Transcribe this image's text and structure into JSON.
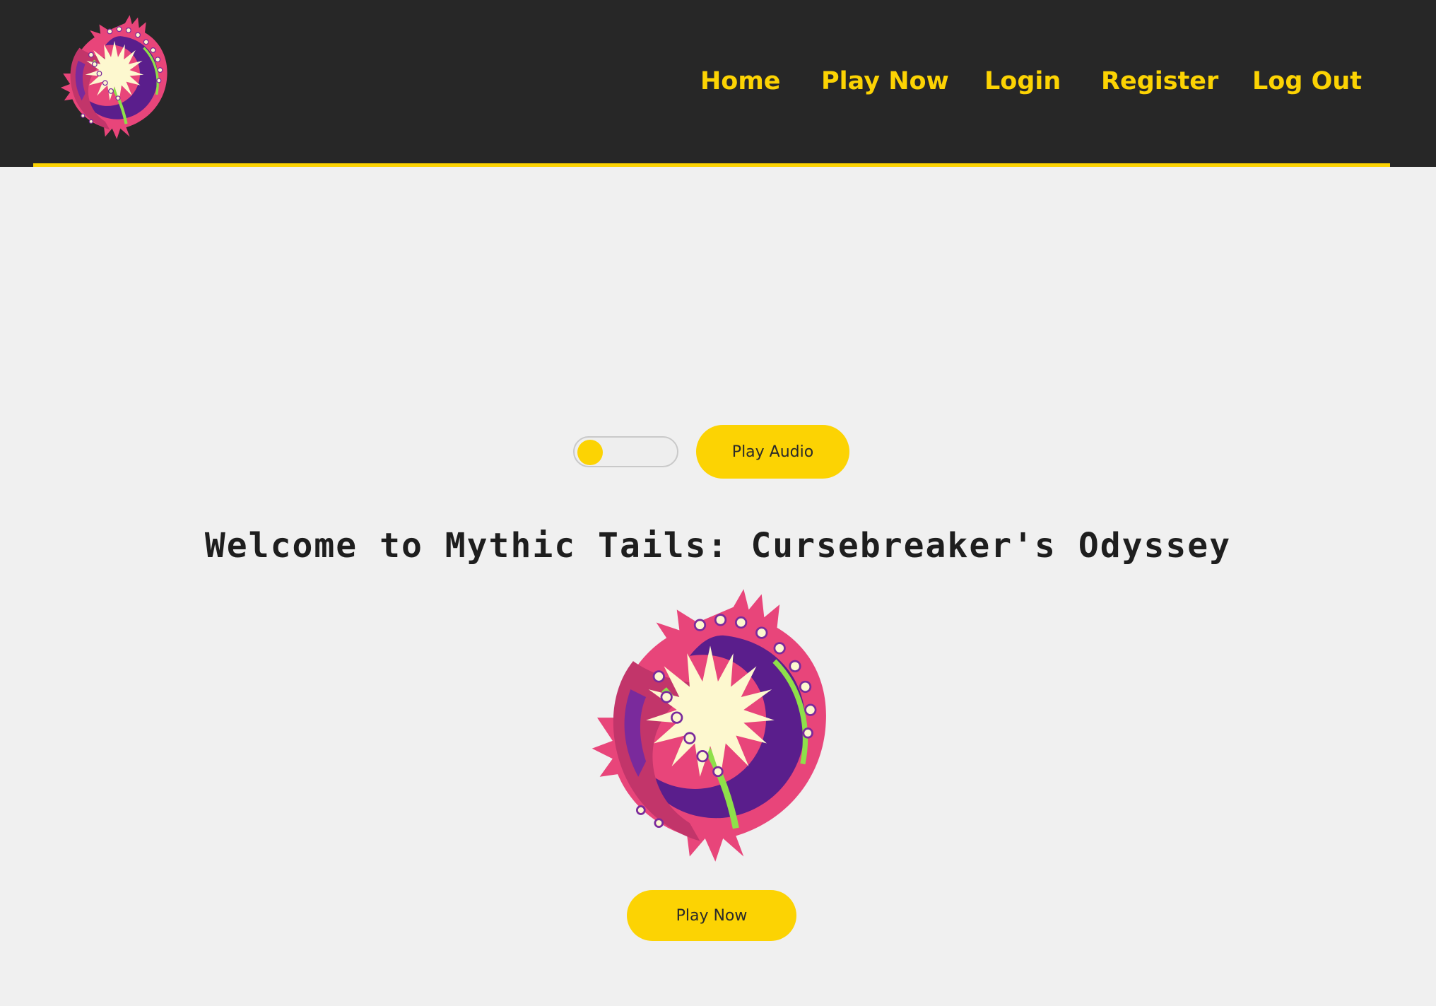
{
  "header": {
    "logo_icon": "serpent-sun-logo",
    "nav": {
      "home": "Home",
      "play_now": "Play Now",
      "login": "Login",
      "register": "Register",
      "log_out": "Log Out"
    }
  },
  "controls": {
    "audio_toggle_on": false,
    "play_audio_label": "Play Audio"
  },
  "main": {
    "title": "Welcome to Mythic Tails: Cursebreaker's Odyssey",
    "hero_icon": "serpent-sun-logo",
    "play_now_label": "Play Now"
  },
  "colors": {
    "accent": "#fcd303",
    "header_bg": "#272727",
    "page_bg": "#f0f0f0",
    "logo_pink": "#e8457a",
    "logo_purple": "#5a1e8c",
    "logo_cream": "#fdf8cf",
    "logo_green": "#8ee04a"
  }
}
